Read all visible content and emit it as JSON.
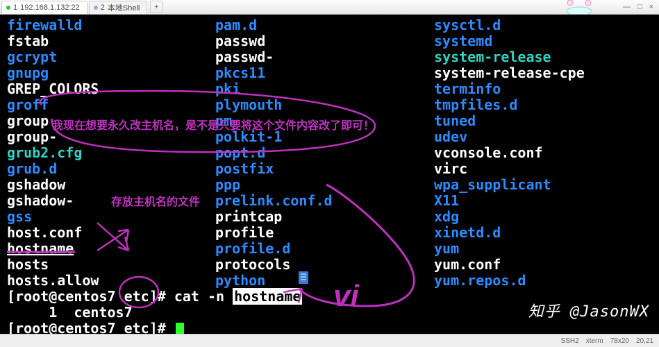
{
  "tabs": {
    "t1_index": "1",
    "t1_label": "192.168.1.132:22",
    "t2_index": "2",
    "t2_label": "本地Shell",
    "add": "+"
  },
  "winctl": {
    "min": "—",
    "max": "□",
    "close": "×"
  },
  "col1": {
    "i0": "firewalld",
    "i1": "fstab",
    "i2": "gcrypt",
    "i3": "gnupg",
    "i4": "GREP_COLORS",
    "i5": "groff",
    "i6": "group",
    "i7": "group-",
    "i8": "grub2.cfg",
    "i9": "grub.d",
    "i10": "gshadow",
    "i11": "gshadow-",
    "i12": "gss",
    "i13": "host.conf",
    "i14": "hostname",
    "i15": "hosts",
    "i16": "hosts.allow"
  },
  "col2": {
    "i0": "pam.d",
    "i1": "passwd",
    "i2": "passwd-",
    "i3": "pkcs11",
    "i4": "pki",
    "i5": "plymouth",
    "i6": "pm",
    "i7": "polkit-1",
    "i8": "popt.d",
    "i9": "postfix",
    "i10": "ppp",
    "i11": "prelink.conf.d",
    "i12": "printcap",
    "i13": "profile",
    "i14": "profile.d",
    "i15": "protocols",
    "i16": "python"
  },
  "col3": {
    "i0": "sysctl.d",
    "i1": "systemd",
    "i2": "system-release",
    "i3": "system-release-cpe",
    "i4": "terminfo",
    "i5": "tmpfiles.d",
    "i6": "tuned",
    "i7": "udev",
    "i8": "vconsole.conf",
    "i9": "virc",
    "i10": "wpa_supplicant",
    "i11": "X11",
    "i12": "xdg",
    "i13": "xinetd.d",
    "i14": "yum",
    "i15": "yum.conf",
    "i16": "yum.repos.d"
  },
  "prompt1": {
    "full": "[root@centos7 etc]# cat -n ",
    "hl": "hostname"
  },
  "output": {
    "line": "     1\tcentos7"
  },
  "prompt2": {
    "full": "[root@centos7 etc]# "
  },
  "annot": {
    "a1": "我现在想要永久改主机名，是不是只要将这个文件内容改了即可！",
    "a2": "存放主机名的文件",
    "a3": "vi"
  },
  "watermark": "知乎 @JasonWX",
  "status": {
    "s1": "SSH2",
    "s2": "xterm",
    "s3": "78x20",
    "s4": "20,21"
  },
  "colors": {
    "annotation": "#c030c0",
    "dir": "#2a8cff",
    "sym": "#2dd4c4"
  }
}
